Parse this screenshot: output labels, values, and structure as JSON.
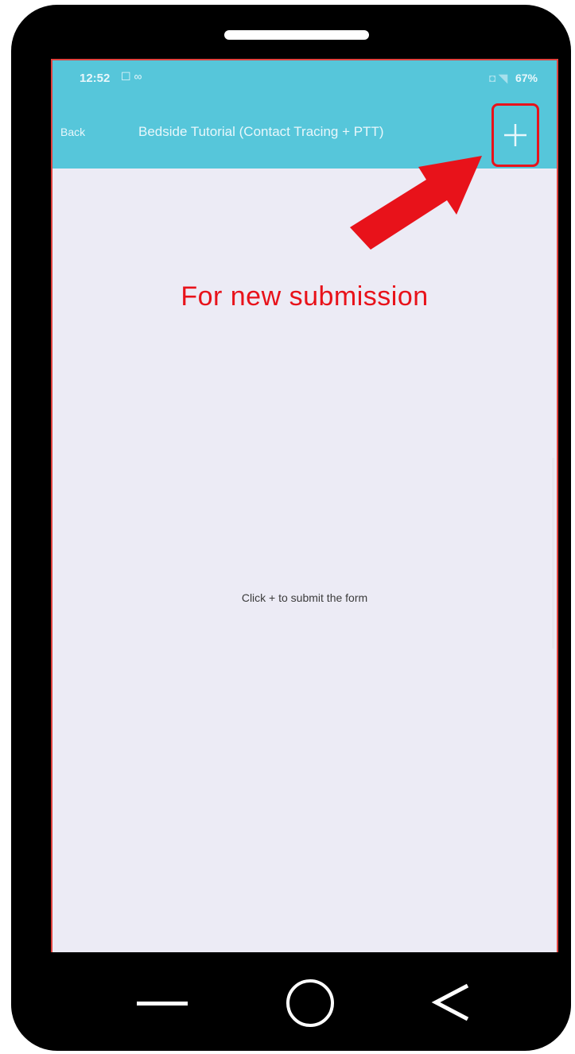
{
  "status_bar": {
    "time": "12:52",
    "left_icons": "☐ ∞",
    "right_icons": "◘ ◥",
    "battery": "67%"
  },
  "app_bar": {
    "back_label": "Back",
    "title": "Bedside Tutorial (Contact Tracing + PTT)",
    "add_button_glyph": "+"
  },
  "annotation": {
    "text": "For new submission",
    "color": "#e8121a"
  },
  "content": {
    "empty_message": "Click + to submit the form"
  },
  "colors": {
    "appbar": "#56c6da",
    "screen_background": "#ecebf5",
    "phone_frame": "#000000"
  },
  "icons": {
    "add": "plus-icon",
    "arrow": "red-arrow-icon",
    "nav_recent": "recent-apps-icon",
    "nav_home": "home-icon",
    "nav_back": "back-icon"
  }
}
